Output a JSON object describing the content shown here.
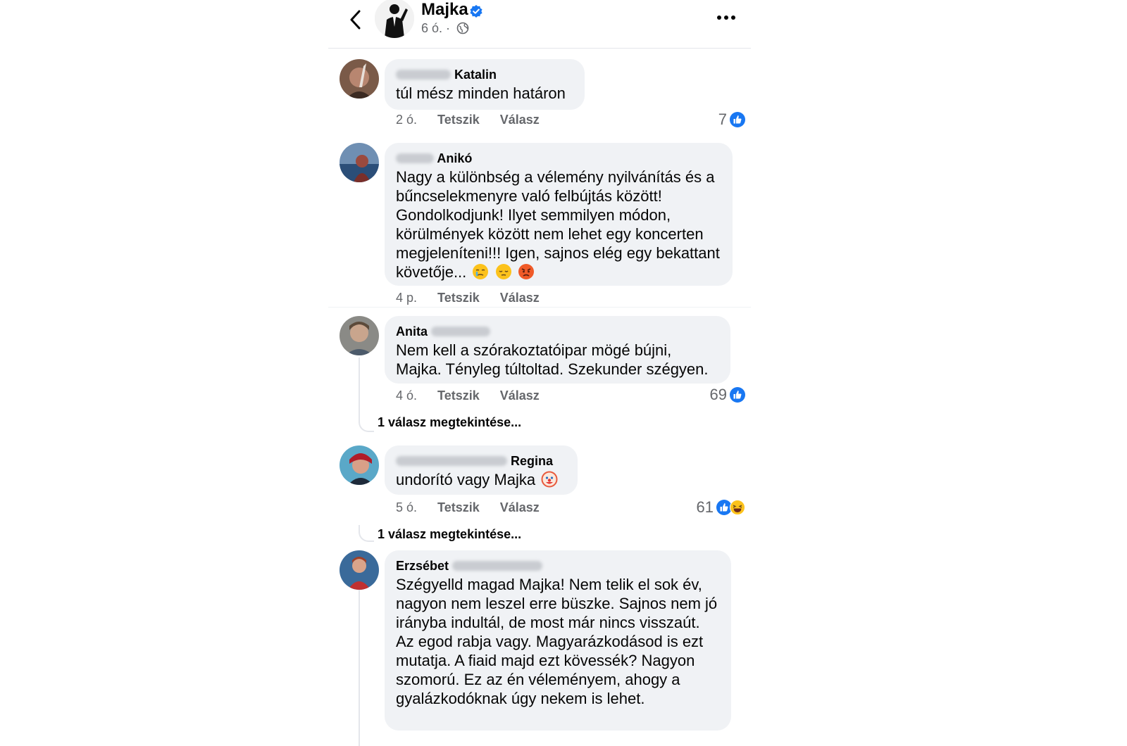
{
  "header": {
    "page_name": "Majka",
    "meta_time": "6 ó. ·"
  },
  "actions": {
    "like": "Tetszik",
    "reply": "Válasz"
  },
  "colors": {
    "facebook_blue": "#1877f2",
    "bubble_bg": "#f0f2f5",
    "meta_gray": "#65676b"
  },
  "comments": [
    {
      "author_first": "",
      "author_last": "Katalin",
      "text": "túl mész minden határon",
      "time": "2 ó.",
      "reactions": "7",
      "reaction_icons": [
        "like-icon"
      ]
    },
    {
      "author_first": "",
      "author_last": "Anikó",
      "text": "Nagy a különbség a vélemény nyilvánítás és a bűncselekmenyre való felbújtás között! Gondolkodjunk! Ilyet semmilyen módon, körülmények között nem lehet egy koncerten megjeleníteni!!! Igen, sajnos elég egy bekattant követője...",
      "emojis": [
        "crying-face-emoji",
        "pensive-face-emoji",
        "angry-face-emoji"
      ],
      "time": "4 p."
    },
    {
      "author_first": "Anita",
      "author_last": "",
      "text": "Nem kell a szórakoztatóipar mögé bújni, Majka. Tényleg túltoltad. Szekunder szégyen.",
      "time": "4 ó.",
      "reactions": "69",
      "reaction_icons": [
        "like-icon"
      ],
      "replies": "1 válasz megtekintése..."
    },
    {
      "author_first": "",
      "author_last": "Regina",
      "text": "undorító vagy Majka",
      "emojis": [
        "clown-face-emoji"
      ],
      "time": "5 ó.",
      "reactions": "61",
      "reaction_icons": [
        "like-icon",
        "haha-icon"
      ],
      "replies": "1 válasz megtekintése..."
    },
    {
      "author_first": "Erzsébet",
      "author_last": "",
      "text": "Szégyelld magad Majka! Nem telik el sok év, nagyon nem leszel erre büszke. Sajnos nem jó irányba indultál, de most már nincs visszaút. Az egod rabja vagy. Magyarázkodásod is ezt mutatja. A fiaid majd ezt kövessék? Nagyon szomorú. Ez az én véleményem, ahogy a gyalázkodóknak úgy nekem is lehet."
    }
  ]
}
